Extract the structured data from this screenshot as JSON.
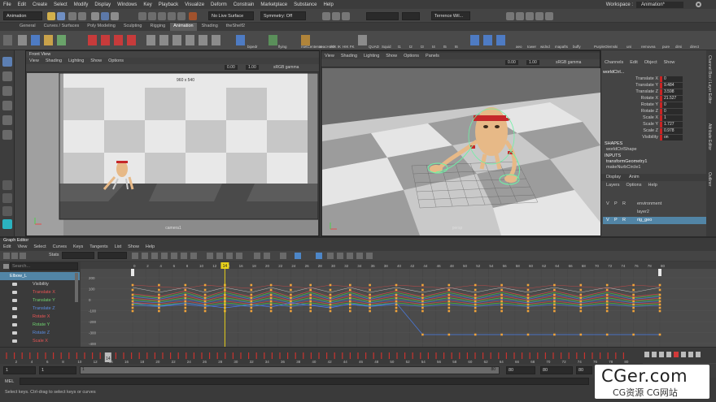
{
  "menubar": {
    "items": [
      "File",
      "Edit",
      "Create",
      "Select",
      "Modify",
      "Display",
      "Windows",
      "Key",
      "Playback",
      "Visualize",
      "Deform",
      "Constrain",
      "Marketplace",
      "Substance",
      "Help"
    ],
    "workspace_label": "Workspace :",
    "workspace_value": "Animation*"
  },
  "statusline": {
    "mode": "Animation",
    "surface": "No Live Surface",
    "symmetry": "Symmetry: Off",
    "user": "Terrence Wil..."
  },
  "shelf": {
    "tabs": [
      "General",
      "Curves / Surfaces",
      "Poly Modeling",
      "Sculpting",
      "Rigging",
      "Animation",
      "Shading",
      "theShelf2"
    ],
    "active_tab": "Animation",
    "labels": [
      "bipedr",
      "flying",
      "rsetCenteron",
      "seacHold",
      "HIK IK",
      "HIK FK",
      "QUAD",
      "Squid",
      "t1",
      "t2",
      "t3",
      "t4",
      "t5",
      "t6",
      "aeo",
      "tower",
      "widnd",
      "mapafts",
      "buffy",
      "PurpleOlemski",
      "uni",
      "removea",
      "pure",
      "dirsi",
      "direct"
    ]
  },
  "front_view": {
    "title": "Front View",
    "menu": [
      "View",
      "Shading",
      "Lighting",
      "Show",
      "Options"
    ],
    "resolution": "960 x 540",
    "camera": "camera1",
    "value_a": "0.00",
    "value_b": "1.00",
    "color_space": "sRGB gamma"
  },
  "persp_view": {
    "menu": [
      "View",
      "Shading",
      "Lighting",
      "Show",
      "Options",
      "Panels"
    ],
    "camera": "persp",
    "value_a": "0.00",
    "value_b": "1.00",
    "color_space": "sRGB gamma"
  },
  "channel_box": {
    "menu": [
      "Channels",
      "Edit",
      "Object",
      "Show"
    ],
    "object": "worldCtrl...",
    "channels": [
      {
        "name": "Translate X",
        "value": "0"
      },
      {
        "name": "Translate Y",
        "value": "9.484"
      },
      {
        "name": "Translate Z",
        "value": "3.598"
      },
      {
        "name": "Rotate X",
        "value": "21.527"
      },
      {
        "name": "Rotate Y",
        "value": "0"
      },
      {
        "name": "Rotate Z",
        "value": "0"
      },
      {
        "name": "Scale X",
        "value": "1"
      },
      {
        "name": "Scale Y",
        "value": "1.727"
      },
      {
        "name": "Scale Z",
        "value": "0.978"
      },
      {
        "name": "Visibility",
        "value": "on"
      }
    ],
    "shapes_header": "SHAPES",
    "shape": "worldCtrlShape",
    "inputs_header": "INPUTS",
    "inputs": [
      "transformGeometry1",
      "makeNurbCircle1"
    ],
    "display_tabs": [
      "Display",
      "Anim"
    ],
    "display_menu": [
      "Layers",
      "Options",
      "Help"
    ],
    "layers": [
      {
        "v": "V",
        "p": "P",
        "r": "R",
        "name": "environment"
      },
      {
        "v": "",
        "p": "",
        "r": "",
        "name": "layer2"
      },
      {
        "v": "V",
        "p": "P",
        "r": "R",
        "name": "rig_geo"
      }
    ],
    "side_labels": [
      "Channel Box / Layer Editor",
      "Attribute Editor",
      "Outliner"
    ]
  },
  "graph_editor": {
    "title": "Graph Editor",
    "menu": [
      "Edit",
      "View",
      "Select",
      "Curves",
      "Keys",
      "Tangents",
      "List",
      "Show",
      "Help"
    ],
    "stats_label": "Stats",
    "search_placeholder": "Search...",
    "frame_ticks": [
      "0",
      "2",
      "4",
      "6",
      "8",
      "10",
      "12",
      "14",
      "16",
      "18",
      "20",
      "22",
      "24",
      "26",
      "28",
      "30",
      "32",
      "34",
      "36",
      "38",
      "40",
      "42",
      "44",
      "46",
      "48",
      "50",
      "52",
      "54",
      "56",
      "58",
      "60",
      "62",
      "64",
      "66",
      "68",
      "70",
      "72",
      "74",
      "76",
      "78",
      "80"
    ],
    "current_frame": "14",
    "y_ticks": [
      "200",
      "100",
      "0",
      "-100",
      "-200",
      "-300",
      "-400"
    ],
    "outliner": [
      {
        "name": "Elbow_L",
        "color": "#ffffff",
        "selected": true
      },
      {
        "name": "Visibility",
        "color": "#cfcfcf"
      },
      {
        "name": "Translate X",
        "color": "#e85454"
      },
      {
        "name": "Translate Y",
        "color": "#6fd16f"
      },
      {
        "name": "Translate Z",
        "color": "#5b8de0"
      },
      {
        "name": "Rotate X",
        "color": "#e85454"
      },
      {
        "name": "Rotate Y",
        "color": "#6fd16f"
      },
      {
        "name": "Rotate Z",
        "color": "#5b8de0"
      },
      {
        "name": "Scale X",
        "color": "#e85454"
      },
      {
        "name": "Scale Y",
        "color": "#6fd16f"
      },
      {
        "name": "Scale Z",
        "color": "#5b8de0"
      }
    ],
    "curve_colors": {
      "x": "#e84a4a",
      "y": "#4ad24a",
      "z": "#4a7de8",
      "vis": "#d8d8d8",
      "key": "#f2a43a",
      "current": "#e8d11a"
    }
  },
  "time_slider": {
    "ticks": [
      "2",
      "4",
      "6",
      "8",
      "10",
      "12",
      "14",
      "16",
      "18",
      "20",
      "22",
      "24",
      "26",
      "28",
      "30",
      "32",
      "34",
      "36",
      "38",
      "40",
      "42",
      "44",
      "46",
      "48",
      "50",
      "52",
      "54",
      "56",
      "58",
      "60",
      "62",
      "64",
      "66",
      "68",
      "70",
      "72",
      "74",
      "76",
      "78",
      "80"
    ],
    "current": "14"
  },
  "range_slider": {
    "start": "1",
    "inner_start": "1",
    "inner_end": "80",
    "end": "80",
    "anim_end": "80",
    "field": "80"
  },
  "command_line": {
    "lang": "MEL",
    "help": "Select keys. Ctrl-drag to select keys or curves"
  },
  "watermark": {
    "title": "CGer.com",
    "subtitle": "CG资源 CG网站"
  }
}
